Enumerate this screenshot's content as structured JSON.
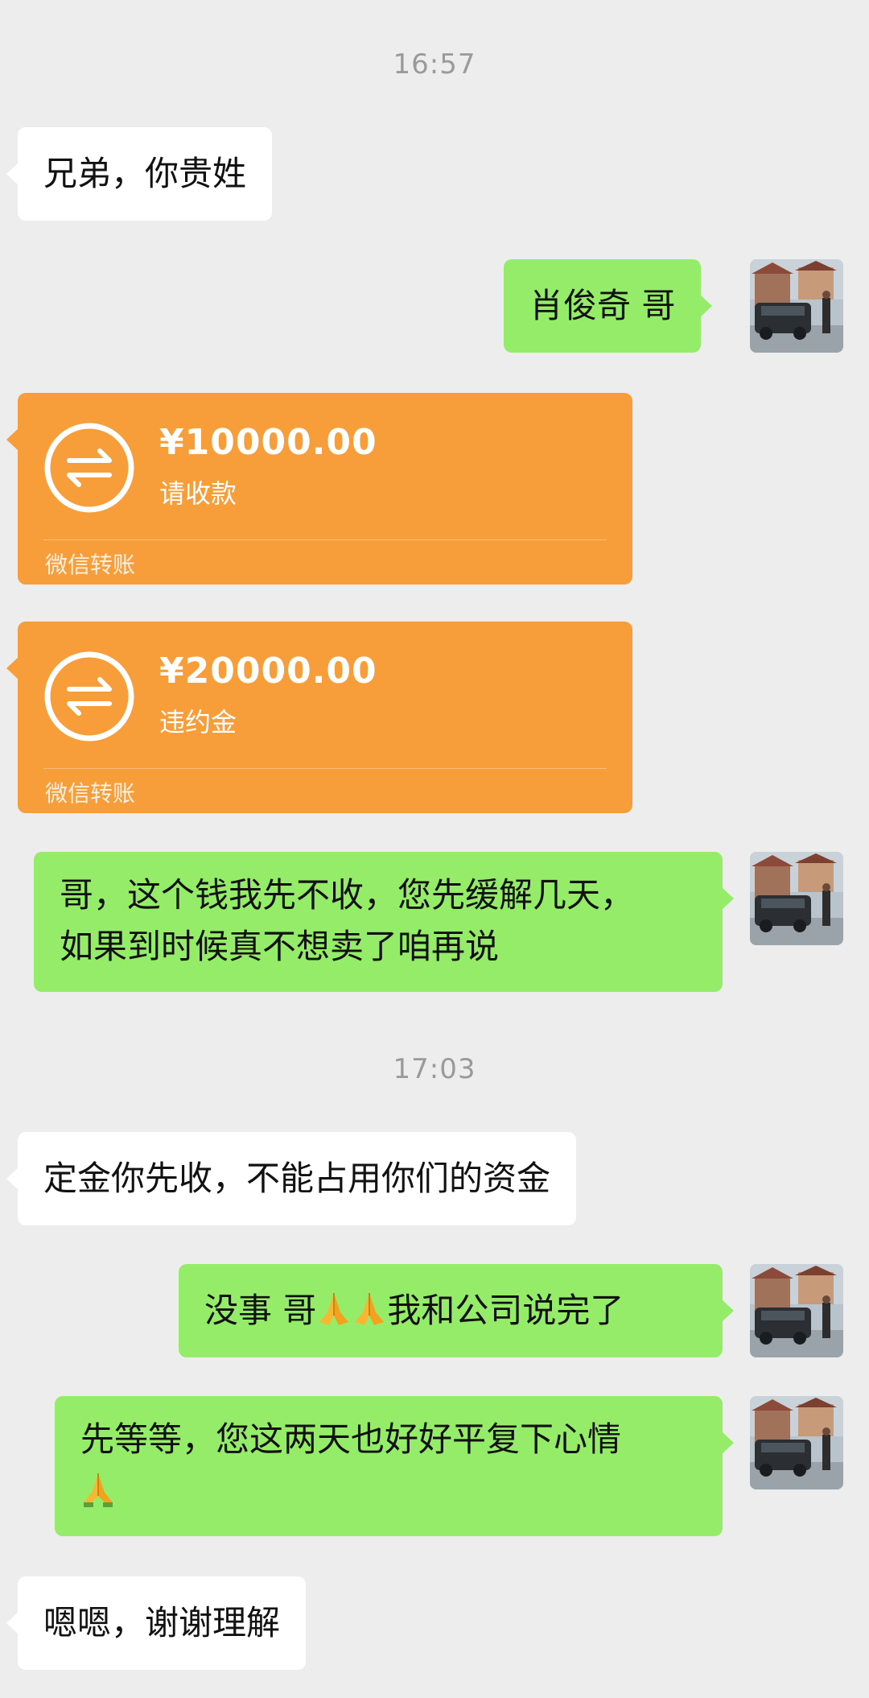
{
  "timestamps": [
    "16:57",
    "17:03"
  ],
  "messages": {
    "m1": "兄弟，你贵姓",
    "m2": "肖俊奇 哥",
    "m3": "哥，这个钱我先不收，您先缓解几天，",
    "m3b": "如果到时候真不想卖了咱再说",
    "m4": "定金你先收，不能占用你们的资金",
    "m5a": "没事 哥",
    "m5b": "我和公司说完了",
    "m6": "先等等，您这两天也好好平复下心情",
    "m7": "嗯嗯，谢谢理解"
  },
  "transfers": [
    {
      "amount": "¥10000.00",
      "note": "请收款",
      "footer": "微信转账"
    },
    {
      "amount": "¥20000.00",
      "note": "违约金",
      "footer": "微信转账"
    }
  ],
  "icons": {
    "transfer": "transfer-arrows-icon",
    "emoji_praying": "folded-hands-emoji",
    "avatar": "avatar-car-photo"
  },
  "colors": {
    "background": "#ededed",
    "bubble_left": "#ffffff",
    "bubble_right": "#95ec69",
    "transfer": "#f79d3a"
  }
}
